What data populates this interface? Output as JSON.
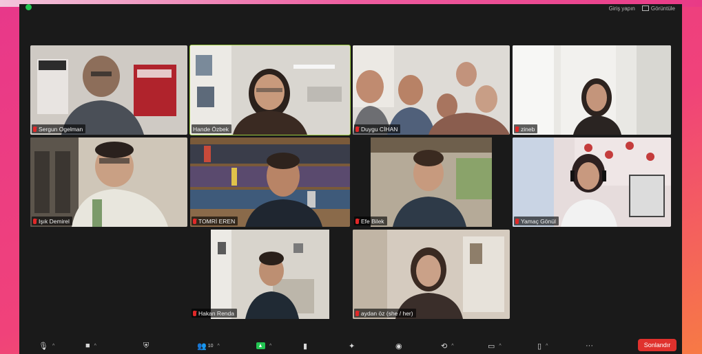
{
  "window": {
    "top_right": {
      "view_label": "Görüntüle",
      "login_label": "Giriş yapın"
    }
  },
  "participants": [
    {
      "name": "Sergun Ogelman",
      "muted": true,
      "speaking": false
    },
    {
      "name": "Hande Özbek",
      "muted": false,
      "speaking": true
    },
    {
      "name": "Duygu CİHAN",
      "muted": true,
      "speaking": false
    },
    {
      "name": "zineb",
      "muted": true,
      "speaking": false
    },
    {
      "name": "Işık Demirel",
      "muted": true,
      "speaking": false
    },
    {
      "name": "TOMRİ EREN",
      "muted": true,
      "speaking": false
    },
    {
      "name": "Efe Bilek",
      "muted": true,
      "speaking": false
    },
    {
      "name": "Yamaç Gönül",
      "muted": true,
      "speaking": false
    },
    {
      "name": "Hakan Renda",
      "muted": true,
      "speaking": false
    },
    {
      "name": "aydan öz (she / her)",
      "muted": true,
      "speaking": false
    }
  ],
  "toolbar": {
    "participants_count": "10",
    "end_label": "Sonlandır"
  },
  "colors": {
    "active_border": "#9ccc3f",
    "end_button": "#e0312d",
    "muted_mic": "#e02828",
    "share_green": "#23c552"
  }
}
